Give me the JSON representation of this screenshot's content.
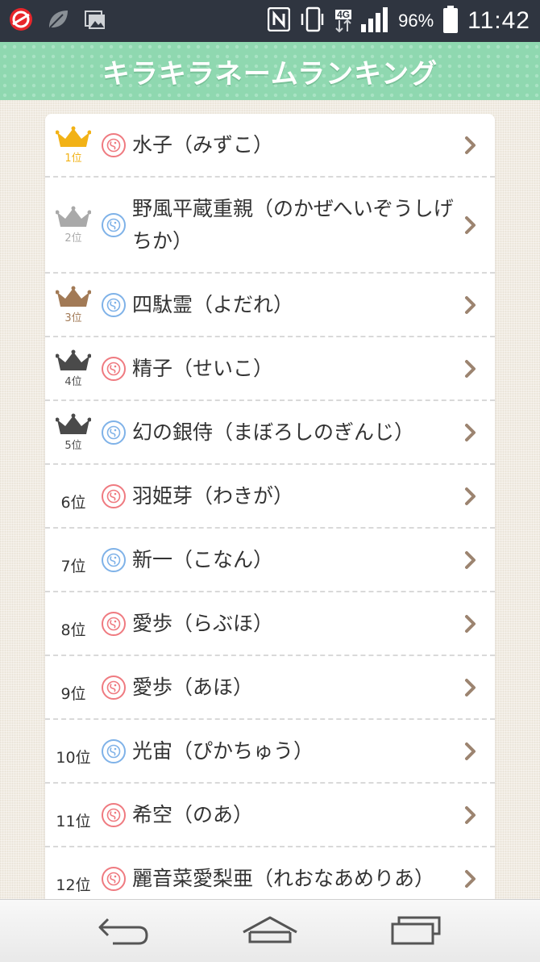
{
  "status_bar": {
    "battery_percent": "96%",
    "time": "11:42",
    "network": "4G"
  },
  "header": {
    "title": "キラキラネームランキング"
  },
  "colors": {
    "gold": "#f2b216",
    "silver": "#a9a9a9",
    "bronze": "#a27a56",
    "dark": "#4a4a4a",
    "girl": "#ef7a80",
    "boy": "#7fb2e8",
    "chevron": "#9c8470",
    "header_green": "#8fd8b0"
  },
  "rankings": [
    {
      "rank": "1位",
      "sex": "girl",
      "name": "水子（みずこ）",
      "crown": "gold"
    },
    {
      "rank": "2位",
      "sex": "boy",
      "name": "野風平蔵重親（のかぜへいぞうしげちか）",
      "crown": "silver"
    },
    {
      "rank": "3位",
      "sex": "boy",
      "name": "四駄霊（よだれ）",
      "crown": "bronze"
    },
    {
      "rank": "4位",
      "sex": "girl",
      "name": "精子（せいこ）",
      "crown": "dark"
    },
    {
      "rank": "5位",
      "sex": "boy",
      "name": "幻の銀侍（まぼろしのぎんじ）",
      "crown": "dark"
    },
    {
      "rank": "6位",
      "sex": "girl",
      "name": "羽姫芽（わきが）"
    },
    {
      "rank": "7位",
      "sex": "boy",
      "name": "新一（こなん）"
    },
    {
      "rank": "8位",
      "sex": "girl",
      "name": "愛歩（らぶほ）"
    },
    {
      "rank": "9位",
      "sex": "girl",
      "name": "愛歩（あほ）"
    },
    {
      "rank": "10位",
      "sex": "boy",
      "name": "光宙（ぴかちゅう）"
    },
    {
      "rank": "11位",
      "sex": "girl",
      "name": "希空（のあ）"
    },
    {
      "rank": "12位",
      "sex": "girl",
      "name": "麗音菜愛梨亜（れおなあめりあ）"
    }
  ]
}
